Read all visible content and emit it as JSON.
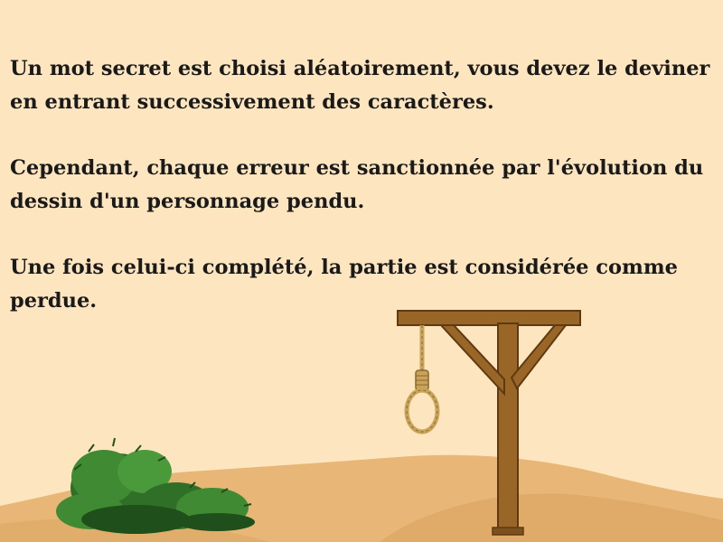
{
  "rules": {
    "paragraph_1": "Un mot secret est choisi aléatoirement, vous devez le deviner en entrant successivement des caractères.",
    "paragraph_2": "Cependant, chaque erreur est sanctionnée par l'évolution du dessin d'un personnage pendu.",
    "paragraph_3": "Une fois celui-ci complété, la partie est considérée comme perdue."
  },
  "scene": {
    "icons": [
      "sand-dunes-icon",
      "bush-icon",
      "gallows-icon",
      "noose-icon"
    ],
    "colors": {
      "background": "#fde5bf",
      "sand": "#e8b777",
      "sand_dark": "#d9a25e",
      "wood": "#9a6628",
      "wood_dark": "#5e3a12",
      "rope": "#c9a35a",
      "bush": "#3f8a33",
      "bush_dark": "#1f4f1a"
    }
  }
}
